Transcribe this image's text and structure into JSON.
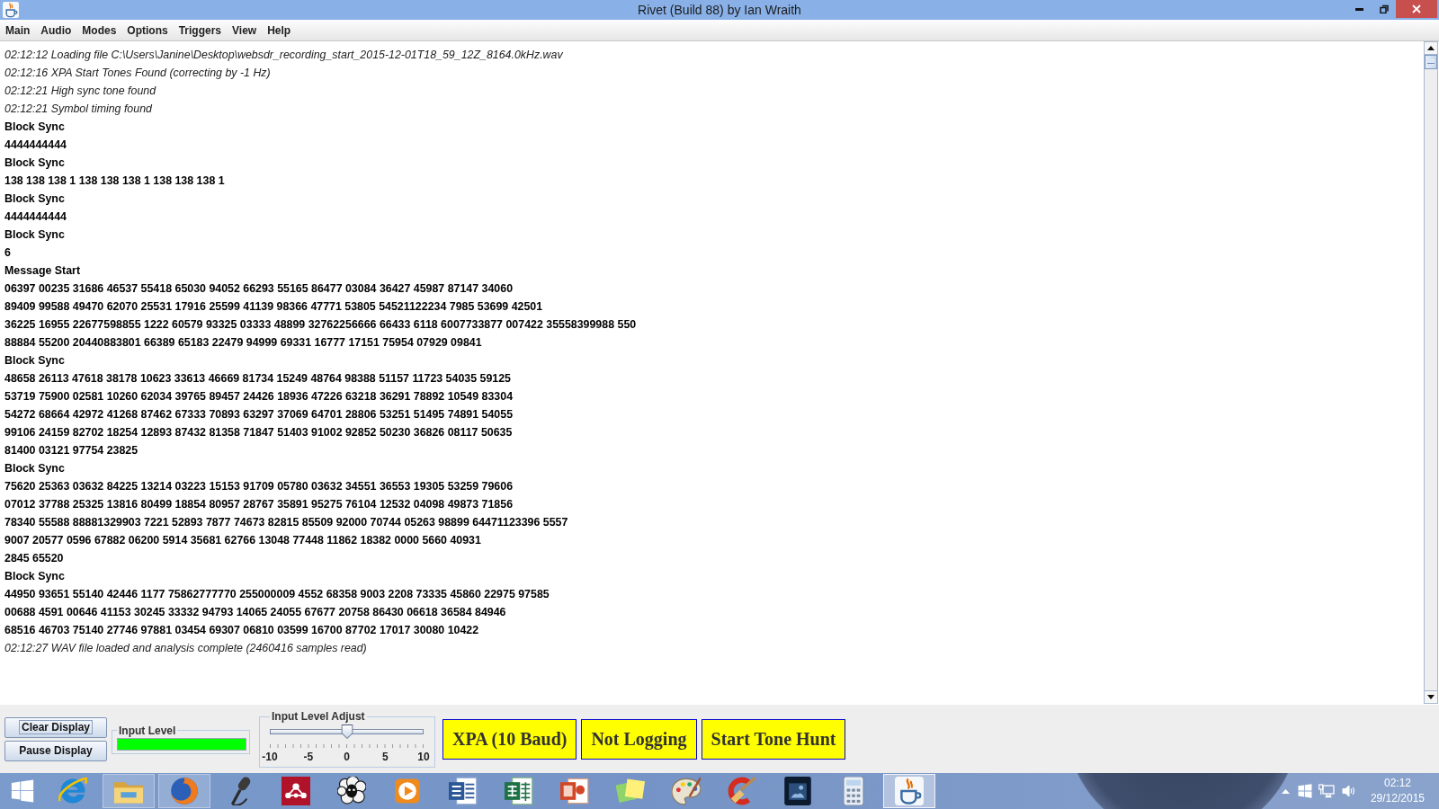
{
  "window": {
    "title": "Rivet (Build 88) by Ian Wraith"
  },
  "menu": [
    "Main",
    "Audio",
    "Modes",
    "Options",
    "Triggers",
    "View",
    "Help"
  ],
  "log": [
    {
      "kind": "info",
      "text": "02:12:12 Loading file C:\\Users\\Janine\\Desktop\\websdr_recording_start_2015-12-01T18_59_12Z_8164.0kHz.wav"
    },
    {
      "kind": "info",
      "text": "02:12:16 XPA Start Tones Found (correcting by -1 Hz)"
    },
    {
      "kind": "info",
      "text": "02:12:21 High sync tone found"
    },
    {
      "kind": "info",
      "text": "02:12:21 Symbol timing found"
    },
    {
      "kind": "data",
      "text": "Block Sync"
    },
    {
      "kind": "data",
      "text": "4444444444"
    },
    {
      "kind": "data",
      "text": "Block Sync"
    },
    {
      "kind": "data",
      "text": "138 138 138 1 138 138 138 1 138 138 138 1"
    },
    {
      "kind": "data",
      "text": "Block Sync"
    },
    {
      "kind": "data",
      "text": "4444444444"
    },
    {
      "kind": "data",
      "text": "Block Sync"
    },
    {
      "kind": "data",
      "text": "6"
    },
    {
      "kind": "data",
      "text": "Message Start"
    },
    {
      "kind": "data",
      "text": "06397 00235 31686 46537 55418 65030 94052 66293 55165 86477 03084 36427 45987 87147 34060"
    },
    {
      "kind": "data",
      "text": "89409 99588 49470 62070 25531 17916 25599 41139 98366 47771 53805 54521122234 7985 53699 42501"
    },
    {
      "kind": "data",
      "text": "36225 16955 22677598855 1222 60579 93325 03333 48899 32762256666 66433 6118 6007733877 007422 35558399988 550"
    },
    {
      "kind": "data",
      "text": "88884 55200 20440883801 66389 65183 22479 94999 69331 16777 17151 75954 07929 09841"
    },
    {
      "kind": "data",
      "text": "Block Sync"
    },
    {
      "kind": "data",
      "text": "48658 26113 47618 38178 10623 33613 46669 81734 15249 48764 98388 51157 11723 54035 59125"
    },
    {
      "kind": "data",
      "text": "53719 75900 02581 10260 62034 39765 89457 24426 18936 47226 63218 36291 78892 10549 83304"
    },
    {
      "kind": "data",
      "text": "54272 68664 42972 41268 87462 67333 70893 63297 37069 64701 28806 53251 51495 74891 54055"
    },
    {
      "kind": "data",
      "text": "99106 24159 82702 18254 12893 87432 81358 71847 51403 91002 92852 50230 36826 08117 50635"
    },
    {
      "kind": "data",
      "text": "81400 03121 97754 23825"
    },
    {
      "kind": "data",
      "text": "Block Sync"
    },
    {
      "kind": "data",
      "text": "75620 25363 03632 84225 13214 03223 15153 91709 05780 03632 34551 36553 19305 53259 79606"
    },
    {
      "kind": "data",
      "text": "07012 37788 25325 13816 80499 18854 80957 28767 35891 95275 76104 12532 04098 49873 71856"
    },
    {
      "kind": "data",
      "text": "78340 55588 88881329903 7221 52893 7877 74673 82815 85509 92000 70744 05263 98899 64471123396 5557"
    },
    {
      "kind": "data",
      "text": "9007 20577 0596 67882 06200 5914 35681 62766 13048 77448 11862 18382 0000 5660 40931"
    },
    {
      "kind": "data",
      "text": "2845 65520"
    },
    {
      "kind": "data",
      "text": "Block Sync"
    },
    {
      "kind": "data",
      "text": "44950 93651 55140 42446 1177 75862777770 255000009 4552 68358 9003 2208 73335 45860 22975 97585"
    },
    {
      "kind": "data",
      "text": "00688 4591 00646 41153 30245 33332 94793 14065 24055 67677 20758 86430 06618 36584 84946"
    },
    {
      "kind": "data",
      "text": "68516 46703 75140 27746 97881 03454 69307 06810 03599 16700 87702 17017 30080 10422"
    },
    {
      "kind": "info",
      "text": "02:12:27 WAV file loaded and analysis complete (2460416 samples read)"
    }
  ],
  "controls": {
    "display_buttons": [
      {
        "label": "Clear Display",
        "focused": true
      },
      {
        "label": "Pause Display",
        "focused": false
      }
    ],
    "input_level": {
      "title": "Input Level",
      "level": 1
    },
    "input_level_adjust": {
      "title": "Input Level Adjust",
      "level": 0.5,
      "tick_labels": [
        "-10",
        "-5",
        "0",
        "5",
        "10"
      ]
    },
    "mode_buttons": [
      "XPA (10 Baud)",
      "Not Logging",
      "Start Tone Hunt"
    ]
  },
  "taskbar": {
    "apps": [
      {
        "running": false,
        "active": false
      },
      {
        "running": true,
        "active": false
      },
      {
        "running": true,
        "active": false
      },
      {
        "running": false,
        "active": false
      },
      {
        "running": false,
        "active": false
      },
      {
        "running": false,
        "active": false
      },
      {
        "running": false,
        "active": false
      },
      {
        "running": false,
        "active": false
      },
      {
        "running": false,
        "active": false
      },
      {
        "running": false,
        "active": false
      },
      {
        "running": false,
        "active": false
      },
      {
        "running": false,
        "active": false
      },
      {
        "running": false,
        "active": false
      },
      {
        "running": false,
        "active": false
      },
      {
        "running": false,
        "active": false
      },
      {
        "running": true,
        "active": true
      }
    ],
    "clock": {
      "time": "02:12",
      "date": "29/12/2015"
    }
  }
}
